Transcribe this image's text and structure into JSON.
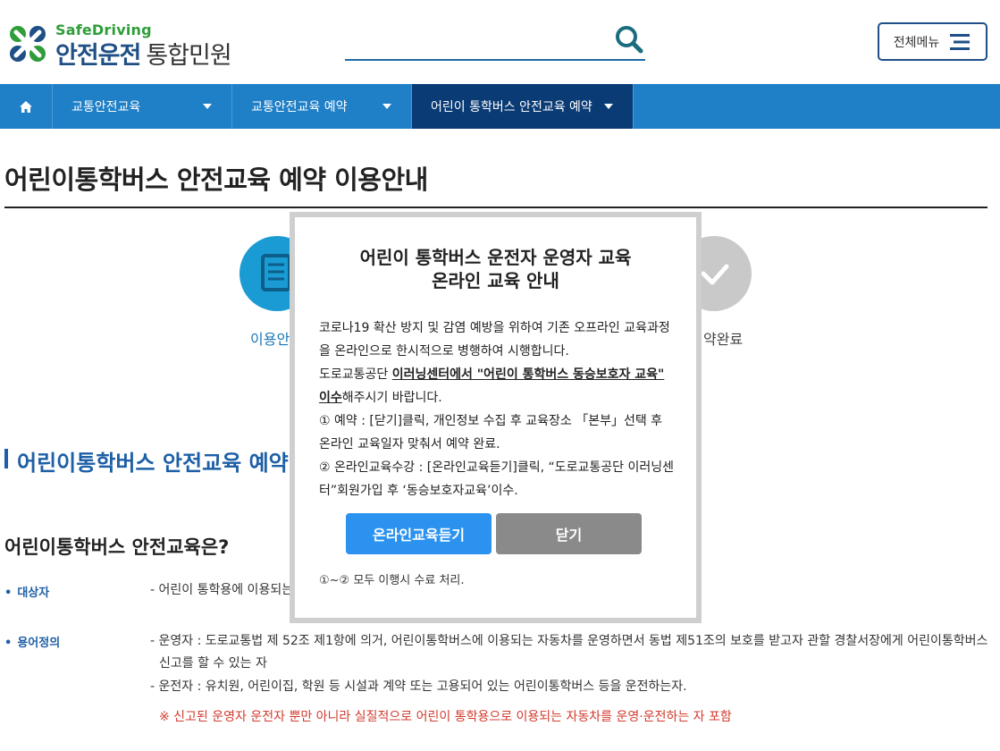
{
  "header": {
    "logo_en": "SafeDriving",
    "logo_ko": "안전운전",
    "logo_sub": "통합민원",
    "search_placeholder": "",
    "menu_label": "전체메뉴"
  },
  "nav": {
    "items": [
      {
        "label": "교통안전교육"
      },
      {
        "label": "교통안전교육 예약"
      },
      {
        "label": "어린이 통학버스 안전교육 예약"
      }
    ]
  },
  "content": {
    "page_title": "어린이통학버스 안전교육 예약 이용안내",
    "step1_label": "이용안",
    "step4_label": "약완료",
    "section_heading": "어린이통학버스 안전교육 예약",
    "question_title": "어린이통학버스 안전교육은?",
    "definitions": [
      {
        "key": "대상자",
        "lines": [
          "- 어린이 통학용에 이용되는"
        ]
      },
      {
        "key": "용어정의",
        "lines": [
          "- 운영자 : 도로교통법 제 52조 제1항에 의거, 어린이통학버스에 이용되는 자동차를 운영하면서 동법 제51조의 보호를 받고자 관할 경찰서장에게 어린이통학버스 신고를 할 수 있는 자",
          "- 운전자 : 유치원, 어린이집, 학원 등 시설과 계약 또는 고용되어 있는 어린이통학버스 등을 운전하는자."
        ]
      }
    ],
    "note_red": "※ 신고된 운영자 운전자 뿐만 아니라 실질적으로 어린이 통학용으로 이용되는 자동차를 운영·운전하는 자 포함"
  },
  "modal": {
    "title_line1": "어린이 통학버스 운전자 운영자 교육",
    "title_line2": "온라인 교육 안내",
    "p1": "코로나19 확산 방지 및 감염 예방을 위하여 기존 오프라인 교육과정을 온라인으로 한시적으로 병행하여 시행합니다.",
    "p2_prefix": "도로교통공단 ",
    "p2_link": "이러닝센터에서 \"어린이 통학버스 동승보호자 교육\" 이수",
    "p2_suffix": "해주시기 바랍니다.",
    "p3": "① 예약 : [닫기]클릭, 개인정보 수집 후 교육장소 「본부」선택 후 온라인 교육일자 맞춰서 예약 완료.",
    "p4": "② 온라인교육수강 : [온라인교육듣기]클릭, “도로교통공단 이러닝센터”회원가입 후 ‘동승보호자교육’이수.",
    "online_button": "온라인교육듣기",
    "close_button": "닫기",
    "note": "①~② 모두 이행시 수료 처리."
  },
  "colors": {
    "nav_bg": "#1f7fc7",
    "nav_active": "#0a3b75",
    "brand_blue": "#1e5fa6",
    "online_btn": "#2b92f0",
    "close_btn": "#8a8a8a",
    "logo_green": "#2e9d3a",
    "note_red": "#d23b2e"
  },
  "icons": [
    "clover-logo-icon",
    "search-icon",
    "hamburger-icon",
    "home-icon",
    "document-icon",
    "check-icon"
  ]
}
